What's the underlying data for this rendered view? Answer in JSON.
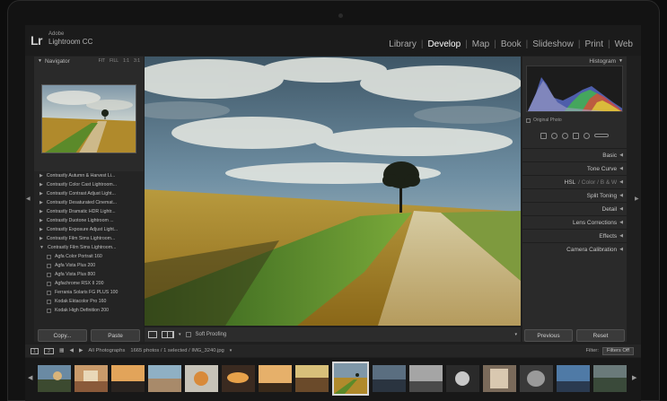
{
  "app": {
    "logo": "Lr",
    "brand_top": "Adobe",
    "brand_name": "Lightroom CC"
  },
  "modules": [
    {
      "label": "Library",
      "active": false
    },
    {
      "label": "Develop",
      "active": true
    },
    {
      "label": "Map",
      "active": false
    },
    {
      "label": "Book",
      "active": false
    },
    {
      "label": "Slideshow",
      "active": false
    },
    {
      "label": "Print",
      "active": false
    },
    {
      "label": "Web",
      "active": false
    }
  ],
  "left_panel": {
    "navigator_title": "Navigator",
    "zoom_options": [
      "FIT",
      "FILL",
      "1:1",
      "3:1"
    ],
    "presets": [
      {
        "label": "Contrastly Autumn & Harvest Li...",
        "type": "folder"
      },
      {
        "label": "Contrastly Color Cast Lightroom...",
        "type": "folder"
      },
      {
        "label": "Contrastly Contrast Adjust Light...",
        "type": "folder"
      },
      {
        "label": "Contrastly Desaturated Cinemat...",
        "type": "folder"
      },
      {
        "label": "Contrastly Dramatic HDR Lightr...",
        "type": "folder"
      },
      {
        "label": "Contrastly Duotone Lightroom ...",
        "type": "folder"
      },
      {
        "label": "Contrastly Exposure Adjust Light...",
        "type": "folder"
      },
      {
        "label": "Contrastly Film Sims Lightroom...",
        "type": "folder"
      },
      {
        "label": "Contrastly Film Sims Lightroom...",
        "type": "folder-open"
      },
      {
        "label": "Agfa Color Portrait 160",
        "type": "item"
      },
      {
        "label": "Agfa Vista Plus 200",
        "type": "item"
      },
      {
        "label": "Agfa Vista Plus 800",
        "type": "item"
      },
      {
        "label": "Agfachrome RSX II 200",
        "type": "item"
      },
      {
        "label": "Ferrania Solaris FG PLUS 100",
        "type": "item"
      },
      {
        "label": "Kodak Ektacolor Pro 160",
        "type": "item"
      },
      {
        "label": "Kodak High Definition 200",
        "type": "item"
      }
    ],
    "copy_label": "Copy...",
    "paste_label": "Paste"
  },
  "toolbar": {
    "soft_proofing_label": "Soft Proofing"
  },
  "right_panel": {
    "histogram_title": "Histogram",
    "original_photo_label": "Original Photo",
    "sections": [
      {
        "label": "Basic"
      },
      {
        "label": "Tone Curve"
      },
      {
        "label": "HSL",
        "extra": "/ Color / B & W"
      },
      {
        "label": "Split Toning"
      },
      {
        "label": "Detail"
      },
      {
        "label": "Lens Corrections"
      },
      {
        "label": "Effects"
      },
      {
        "label": "Camera Calibration"
      }
    ],
    "previous_label": "Previous",
    "reset_label": "Reset"
  },
  "filmstrip_bar": {
    "page_numbers": [
      "1",
      "2"
    ],
    "source_label": "All Photographs",
    "info_text": "1665 photos / 1 selected / IMG_3240.jpg",
    "filter_label": "Filter:",
    "filter_value": "Filters Off"
  },
  "filmstrip": {
    "thumb_count": 14,
    "selected_index": 8
  },
  "colors": {
    "panel_bg": "#2a2a2a",
    "bezel": "#131313",
    "sky": "#6d8aa0",
    "field_gold": "#b08a2c",
    "grass_green": "#5b8a2a"
  }
}
